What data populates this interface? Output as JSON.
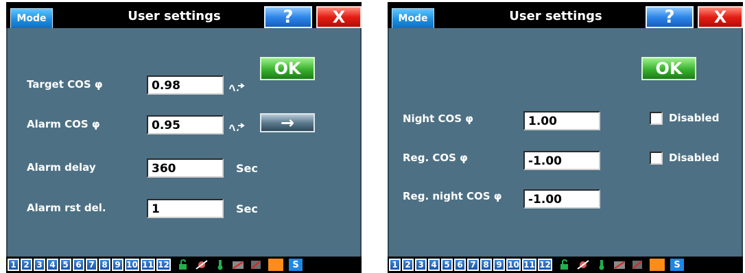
{
  "left": {
    "mode_label": "Mode",
    "title": "User settings",
    "help_label": "?",
    "close_label": "X",
    "ok_label": "OK",
    "arrow_label": "→",
    "rows": [
      {
        "label": "Target COS φ",
        "value": "0.98",
        "unit_icon": "wave-icon"
      },
      {
        "label": "Alarm COS φ",
        "value": "0.95",
        "unit_icon": "wave-icon"
      },
      {
        "label": "Alarm delay",
        "value": "360",
        "unit": "Sec"
      },
      {
        "label": "Alarm rst del.",
        "value": "1",
        "unit": "Sec"
      }
    ]
  },
  "right": {
    "mode_label": "Mode",
    "title": "User settings",
    "help_label": "?",
    "close_label": "X",
    "ok_label": "OK",
    "rows": [
      {
        "label": "Night COS φ",
        "value": "1.00",
        "checkbox_label": "Disabled"
      },
      {
        "label": "Reg. COS φ",
        "value": "-1.00",
        "checkbox_label": "Disabled"
      },
      {
        "label": "Reg. night COS φ",
        "value": "-1.00"
      }
    ]
  },
  "taskbar": {
    "numbers": [
      "1",
      "2",
      "3",
      "4",
      "5",
      "6",
      "7",
      "8",
      "9",
      "10",
      "11",
      "12"
    ],
    "icons": [
      "lock-open-icon",
      "fan-off-icon",
      "thermometer-icon",
      "relay-off-icon",
      "disabled-icon",
      "orange-square-icon",
      "service-icon"
    ],
    "service_label": "S"
  },
  "colors": {
    "client_bg": "#4d7084",
    "ok_green": "#38b12e",
    "close_red": "#e21e14",
    "help_blue": "#2f86e8"
  }
}
